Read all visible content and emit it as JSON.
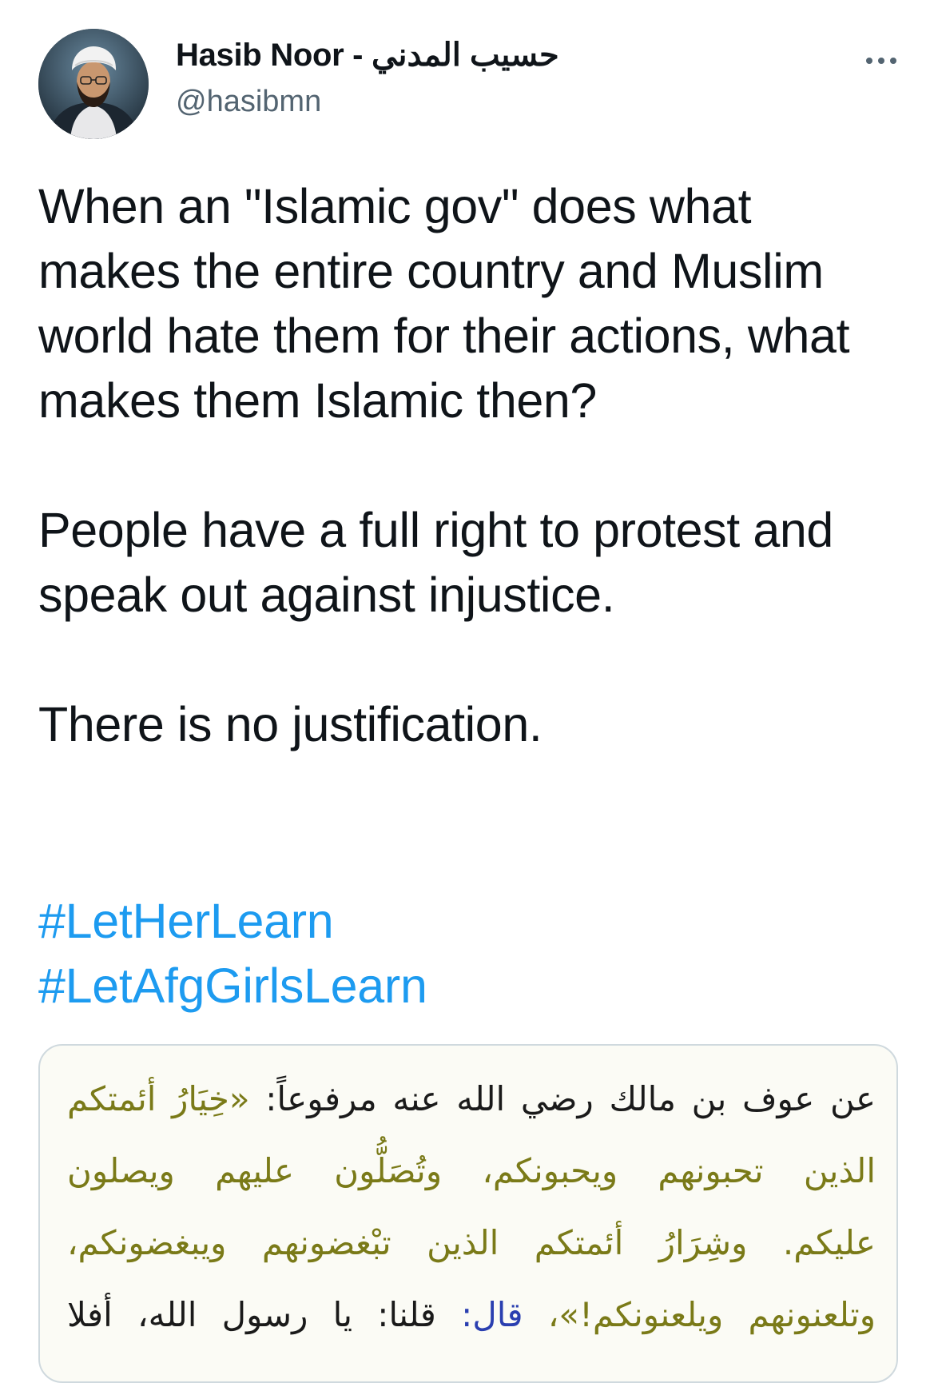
{
  "author": {
    "display_name": "Hasib Noor - حسيب المدني",
    "handle": "@hasibmn"
  },
  "tweet": {
    "paragraphs": [
      "When an \"Islamic gov\" does what makes the entire country and Muslim world hate them for their actions, what makes them Islamic then?",
      "People have a full right to protest and speak out against injustice.",
      "There is no justification."
    ],
    "hashtags": [
      "#LetHerLearn",
      "#LetAfgGirlsLearn"
    ]
  },
  "icons": {
    "more": "more-horizontal-icon"
  },
  "colors": {
    "text": "#0f1419",
    "secondary": "#536471",
    "link": "#1d9bf0",
    "hadith_highlight": "#7a7a18",
    "hadith_blue": "#2a3fb0"
  },
  "media": {
    "lines": [
      {
        "plain": "عن عوف بن مالك رضي الله عنه مرفوعاً: ",
        "olive": "«خِيَارُ أئمتكم",
        "blue": "",
        "tail": ""
      },
      {
        "plain": "",
        "olive": "الذين تحبونهم ويحبونكم، وتُصَلُّون عليهم ويصلون",
        "blue": "",
        "tail": ""
      },
      {
        "plain": "",
        "olive": "عليكم. وشِرَارُ أئمتكم الذين تبْغضونهم ويبغضونكم،",
        "blue": "",
        "tail": ""
      },
      {
        "plain": "",
        "olive": "وتلعنونهم ويلعنونكم!»، ",
        "blue": "قال: ",
        "tail": "قلنا: يا رسول الله، أفلا"
      }
    ]
  }
}
